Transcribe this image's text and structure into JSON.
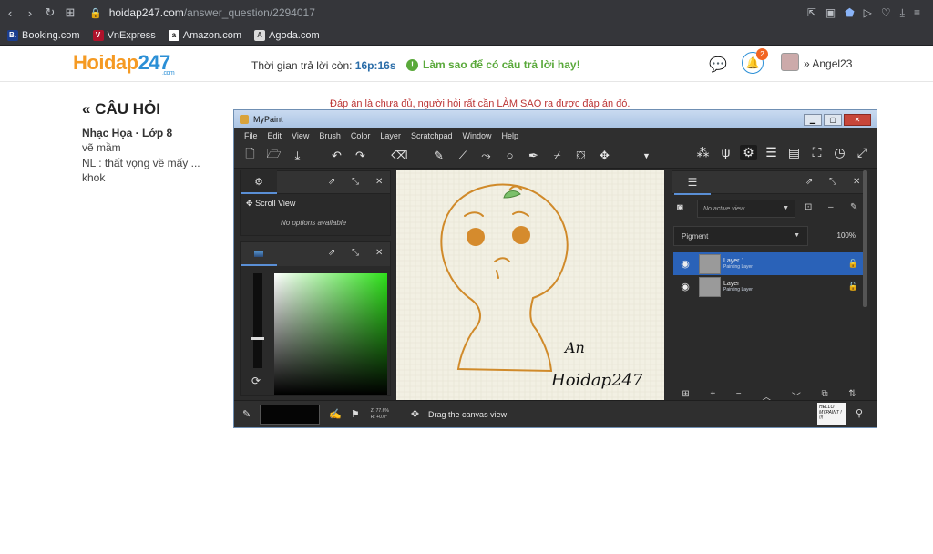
{
  "browser": {
    "nav": {
      "back": "‹",
      "forward": "›",
      "reload": "↻",
      "apps": "⊞"
    },
    "url_host": "hoidap247.com",
    "url_path": "/answer_question/2294017",
    "bookmarks": [
      {
        "label": "Booking.com",
        "icon": "B.",
        "color": "#1a3d8f"
      },
      {
        "label": "VnExpress",
        "icon": "V",
        "color": "#b0122b"
      },
      {
        "label": "Amazon.com",
        "icon": "a",
        "color": "#111111"
      },
      {
        "label": "Agoda.com",
        "icon": "A",
        "color": "#888888"
      }
    ]
  },
  "site": {
    "logo_letter": "H",
    "logo_text": "oidap",
    "logo_digits": "247",
    "logo_dotcom": ".com",
    "timer_label": "Thời gian trả lời còn:",
    "timer_value": "16p:16s",
    "tip": "Làm sao để có câu trả lời hay!",
    "notification_count": "2",
    "username": "Angel23"
  },
  "question": {
    "heading": "« CÂU HỎI",
    "subject": "Nhạc Họa · Lớp 8",
    "lines": [
      "vẽ mầm",
      "NL : thất vọng về mấy ...",
      "khok"
    ],
    "notice": "Đáp án là chưa đủ, người hỏi rất cần LÀM SAO ra được đáp án đó."
  },
  "mypaint": {
    "title": "MyPaint",
    "menu": [
      "File",
      "Edit",
      "View",
      "Brush",
      "Color",
      "Layer",
      "Scratchpad",
      "Window",
      "Help"
    ],
    "scroll_view_title": "Scroll View",
    "scroll_view_empty": "No options available",
    "view_select": "No active view",
    "mode_select": "Pigment",
    "opacity": "100%",
    "layers": [
      {
        "name": "Layer 1",
        "type": "Painting Layer",
        "selected": true
      },
      {
        "name": "Layer",
        "type": "Painting Layer",
        "selected": false
      }
    ],
    "status_msg": "Drag the canvas view",
    "zoom_line1": "Z: 77.6%",
    "zoom_line2": "R: +0.0°",
    "canvas_text1": "An",
    "canvas_text2": "Hoidap247",
    "sticker_line1": "HELLO",
    "sticker_line2": "MYPAINT !",
    "sticker_line3": "!!!"
  }
}
